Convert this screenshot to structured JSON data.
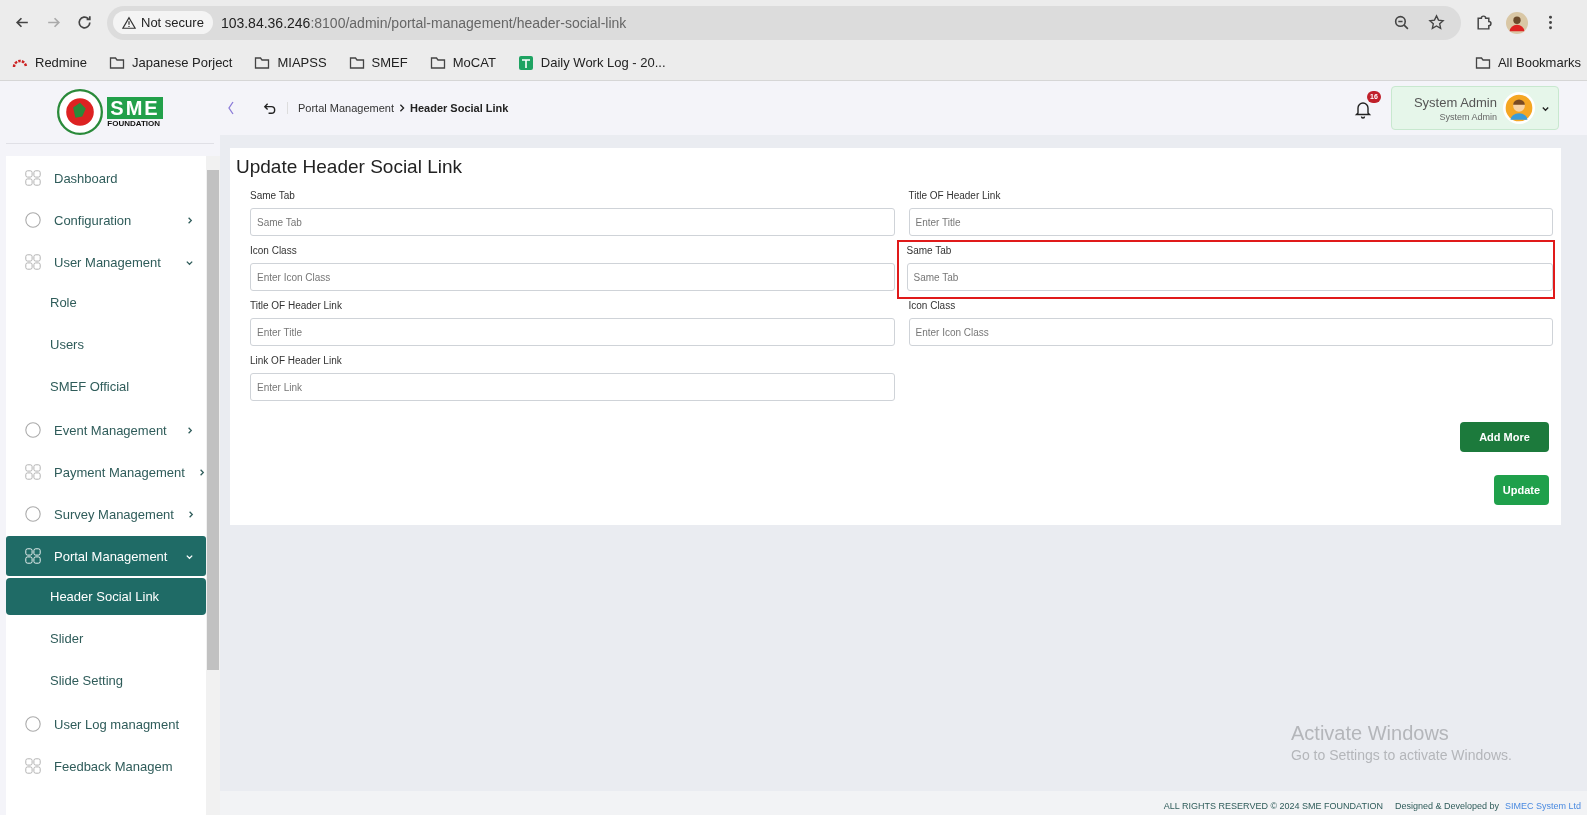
{
  "browser": {
    "not_secure": "Not secure",
    "url_host": "103.84.36.246",
    "url_path": ":8100/admin/portal-management/header-social-link",
    "forward_disabled": true,
    "bookmarks": [
      {
        "label": "Redmine",
        "kind": "site"
      },
      {
        "label": "Japanese Porject",
        "kind": "folder"
      },
      {
        "label": "MIAPSS",
        "kind": "folder"
      },
      {
        "label": "SMEF",
        "kind": "folder"
      },
      {
        "label": "MoCAT",
        "kind": "folder"
      },
      {
        "label": "Daily Work Log - 20...",
        "kind": "sheet"
      }
    ],
    "all_bookmarks": "All Bookmarks"
  },
  "logo": {
    "mark": "SME",
    "subtitle": "FOUNDATION"
  },
  "breadcrumb": [
    {
      "label": "Portal Management",
      "current": false
    },
    {
      "label": "Header Social Link",
      "current": true
    }
  ],
  "notifications": {
    "count": "16"
  },
  "user": {
    "name": "System Admin",
    "role": "System Admin"
  },
  "sidebar": {
    "items": [
      {
        "label": "Dashboard",
        "has_children": false,
        "selected": false
      },
      {
        "label": "Configuration",
        "has_children": true,
        "expanded": false,
        "selected": false
      },
      {
        "label": "User Management",
        "has_children": true,
        "expanded": true,
        "selected": false,
        "children": [
          {
            "label": "Role",
            "selected": false
          },
          {
            "label": "Users",
            "selected": false
          },
          {
            "label": "SMEF Official",
            "selected": false
          }
        ]
      },
      {
        "label": "Event Management",
        "has_children": true,
        "expanded": false,
        "selected": false
      },
      {
        "label": "Payment Management",
        "has_children": true,
        "expanded": false,
        "selected": false
      },
      {
        "label": "Survey Management",
        "has_children": true,
        "expanded": false,
        "selected": false
      },
      {
        "label": "Portal Management",
        "has_children": true,
        "expanded": true,
        "selected": true,
        "children": [
          {
            "label": "Header Social Link",
            "selected": true
          },
          {
            "label": "Slider",
            "selected": false
          },
          {
            "label": "Slide Setting",
            "selected": false
          }
        ]
      },
      {
        "label": "User Log managment",
        "has_children": false,
        "selected": false
      },
      {
        "label": "Feedback Managem",
        "has_children": false,
        "selected": false
      }
    ]
  },
  "form": {
    "title": "Update Header Social Link",
    "fields": [
      {
        "label": "Same Tab",
        "placeholder": "Same Tab",
        "highlighted": false
      },
      {
        "label": "Title OF Header Link",
        "placeholder": "Enter Title",
        "highlighted": false
      },
      {
        "label": "Icon Class",
        "placeholder": "Enter Icon Class",
        "highlighted": false
      },
      {
        "label": "Same Tab",
        "placeholder": "Same Tab",
        "highlighted": true
      },
      {
        "label": "Title OF Header Link",
        "placeholder": "Enter Title",
        "highlighted": false
      },
      {
        "label": "Icon Class",
        "placeholder": "Enter Icon Class",
        "highlighted": false
      },
      {
        "label": "Link OF Header Link",
        "placeholder": "Enter Link",
        "highlighted": false
      }
    ],
    "add_button": "Add More",
    "submit_button": "Update"
  },
  "os_notice": {
    "title": "Activate Windows",
    "text": "Go to Settings to activate Windows."
  },
  "footer": {
    "rights": "ALL RIGHTS RESERVED © 2024 SME FOUNDATION",
    "designed": "Designed & Developed by",
    "company": "SIMEC System Ltd"
  }
}
